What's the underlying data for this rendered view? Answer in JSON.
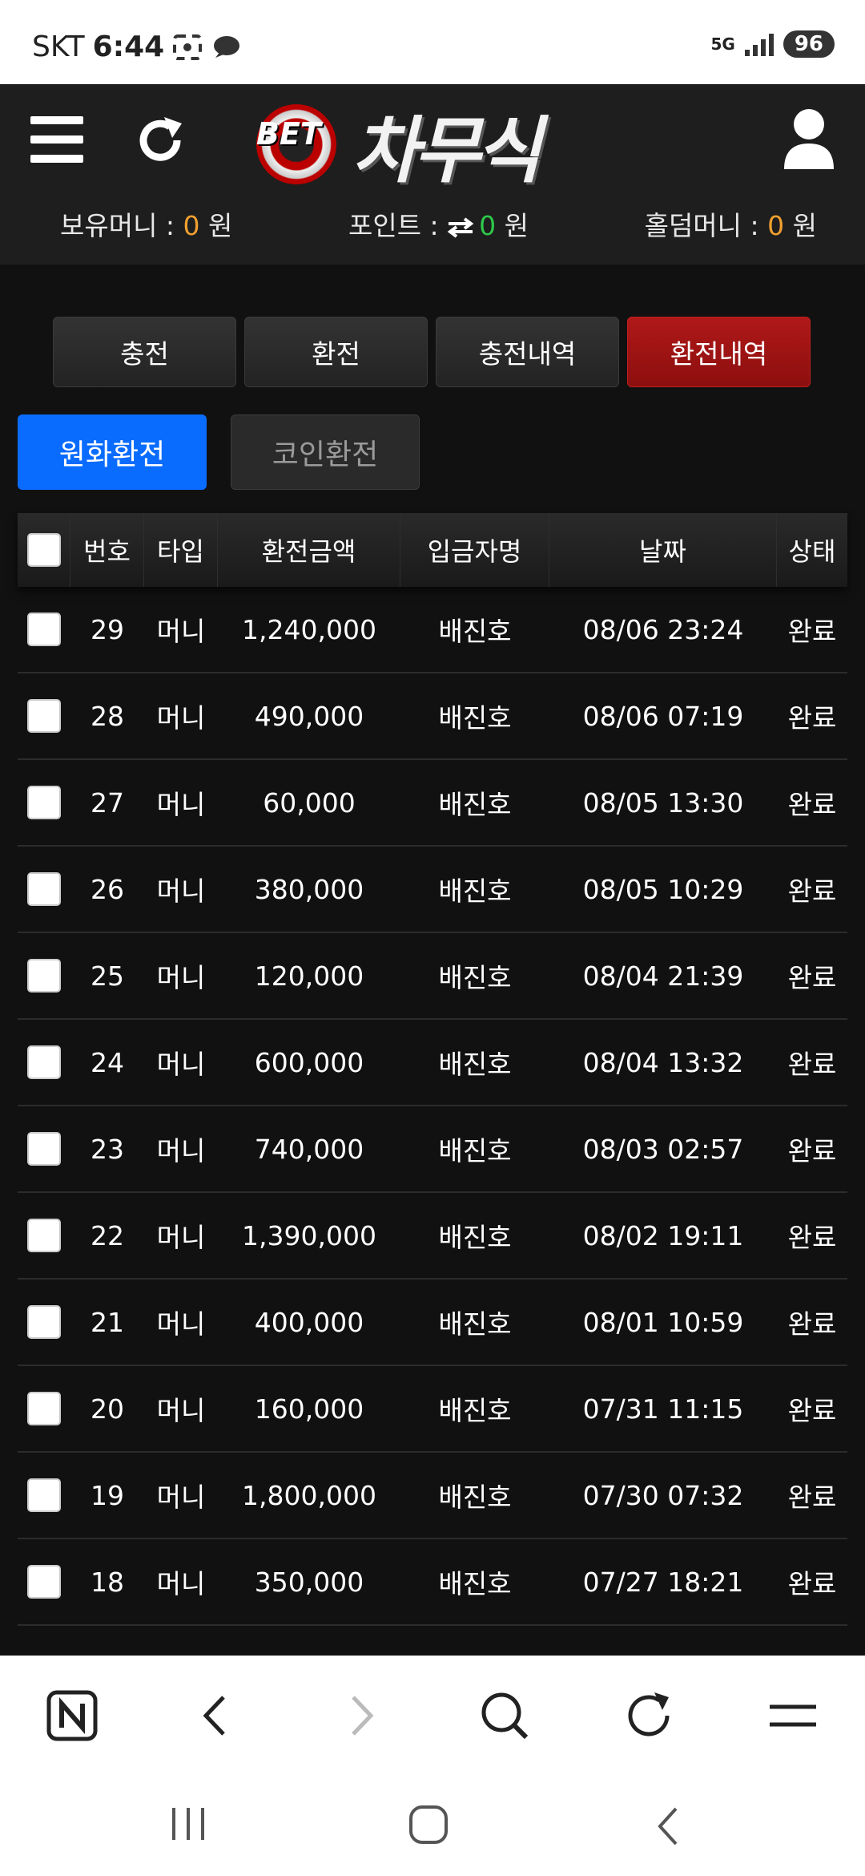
{
  "status": {
    "carrier": "SKT",
    "time": "6:44",
    "network": "5G",
    "battery": "96"
  },
  "header": {
    "logo_bet": "BET",
    "logo_brand": "차무식",
    "balances": [
      {
        "label": "보유머니 : ",
        "value": "0",
        "unit": " 원",
        "color": "#f0a030"
      },
      {
        "label": "포인트 : ",
        "value": "0",
        "unit": " 원",
        "color": "#2ec84a"
      },
      {
        "label": "홀덤머니 : ",
        "value": "0",
        "unit": " 원",
        "color": "#f0a030"
      }
    ]
  },
  "tabs": [
    "충전",
    "환전",
    "충전내역",
    "환전내역"
  ],
  "active_tab": "환전내역",
  "subtabs": [
    "원화환전",
    "코인환전"
  ],
  "active_subtab": "원화환전",
  "table": {
    "headers": [
      "번호",
      "타입",
      "환전금액",
      "입금자명",
      "날짜",
      "상태"
    ],
    "rows": [
      [
        "29",
        "머니",
        "1,240,000",
        "배진호",
        "08/06 23:24",
        "완료"
      ],
      [
        "28",
        "머니",
        "490,000",
        "배진호",
        "08/06 07:19",
        "완료"
      ],
      [
        "27",
        "머니",
        "60,000",
        "배진호",
        "08/05 13:30",
        "완료"
      ],
      [
        "26",
        "머니",
        "380,000",
        "배진호",
        "08/05 10:29",
        "완료"
      ],
      [
        "25",
        "머니",
        "120,000",
        "배진호",
        "08/04 21:39",
        "완료"
      ],
      [
        "24",
        "머니",
        "600,000",
        "배진호",
        "08/04 13:32",
        "완료"
      ],
      [
        "23",
        "머니",
        "740,000",
        "배진호",
        "08/03 02:57",
        "완료"
      ],
      [
        "22",
        "머니",
        "1,390,000",
        "배진호",
        "08/02 19:11",
        "완료"
      ],
      [
        "21",
        "머니",
        "400,000",
        "배진호",
        "08/01 10:59",
        "완료"
      ],
      [
        "20",
        "머니",
        "160,000",
        "배진호",
        "07/31 11:15",
        "완료"
      ],
      [
        "19",
        "머니",
        "1,800,000",
        "배진호",
        "07/30 07:32",
        "완료"
      ],
      [
        "18",
        "머니",
        "350,000",
        "배진호",
        "07/27 18:21",
        "완료"
      ]
    ]
  },
  "colors": {
    "accent_blue": "#0a6cff",
    "active_red": "#b01818",
    "money_orange": "#f0a030",
    "point_green": "#2ec84a"
  }
}
